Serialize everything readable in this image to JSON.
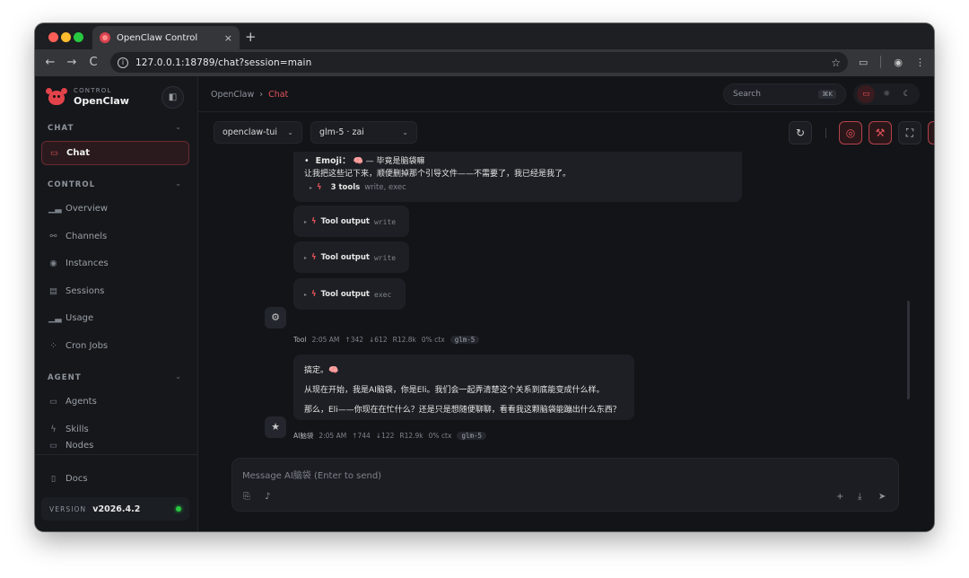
{
  "browser": {
    "tab_title": "OpenClaw Control",
    "tab_close": "×",
    "new_tab": "+",
    "back": "←",
    "forward": "→",
    "reload": "C",
    "url": "127.0.0.1:18789/chat?session=main"
  },
  "brand": {
    "sub": "CONTROL",
    "name": "OpenClaw"
  },
  "sidebar": {
    "sections": [
      {
        "title": "CHAT"
      },
      {
        "title": "CONTROL"
      },
      {
        "title": "AGENT"
      }
    ],
    "items": [
      {
        "label": "Chat",
        "icon": "chat-icon"
      },
      {
        "label": "Overview",
        "icon": "bar-chart-icon"
      },
      {
        "label": "Channels",
        "icon": "link-icon"
      },
      {
        "label": "Instances",
        "icon": "radio-icon"
      },
      {
        "label": "Sessions",
        "icon": "document-icon"
      },
      {
        "label": "Usage",
        "icon": "bar-chart-icon"
      },
      {
        "label": "Cron Jobs",
        "icon": "loader-icon"
      },
      {
        "label": "Agents",
        "icon": "folder-icon"
      },
      {
        "label": "Skills",
        "icon": "zap-icon"
      },
      {
        "label": "Nodes",
        "icon": "monitor-icon"
      },
      {
        "label": "Docs",
        "icon": "book-icon"
      }
    ],
    "version_label": "VERSION",
    "version_value": "v2026.4.2"
  },
  "header": {
    "breadcrumb_root": "OpenClaw",
    "breadcrumb_sep": "›",
    "breadcrumb_current": "Chat",
    "search_placeholder": "Search",
    "search_shortcut": "⌘K"
  },
  "controls": {
    "session_select": "openclaw-tui",
    "model_select": "glm-5 · zai",
    "chevron": "⌄"
  },
  "messages": {
    "assistant_top": {
      "emoji_label": "Emoji：",
      "emoji_text": "🧠 — 毕竟是脑袋嘛",
      "line": "让我把这些记下来，顺便删掉那个引导文件——不需要了，我已经是我了。",
      "tools_label": "3 tools",
      "tools_detail": "write, exec"
    },
    "tool_outputs": [
      {
        "label": "Tool output",
        "detail": "write"
      },
      {
        "label": "Tool output",
        "detail": "write"
      },
      {
        "label": "Tool output",
        "detail": "exec"
      }
    ],
    "tool_meta": {
      "who": "Tool",
      "time": "2:05 AM",
      "up": "↑342",
      "down": "↓612",
      "r": "R12.8k",
      "ctx": "0% ctx",
      "model": "glm-5"
    },
    "assistant_main": {
      "line1": "搞定。🧠",
      "line2": "从现在开始，我是AI脑袋，你是Eli。我们会一起弄清楚这个关系到底能变成什么样。",
      "line3": "那么，Eli——你现在在忙什么？还是只是想随便聊聊，看看我这颗脑袋能蹦出什么东西？"
    },
    "assistant_meta": {
      "who": "AI脑袋",
      "time": "2:05 AM",
      "up": "↑744",
      "down": "↓122",
      "r": "R12.9k",
      "ctx": "0% ctx",
      "model": "glm-5"
    }
  },
  "composer": {
    "placeholder": "Message AI脑袋 (Enter to send)"
  },
  "colors": {
    "accent": "#e2525a",
    "background": "#121418",
    "sidebar": "#15171b",
    "status_ok": "#28c840"
  }
}
